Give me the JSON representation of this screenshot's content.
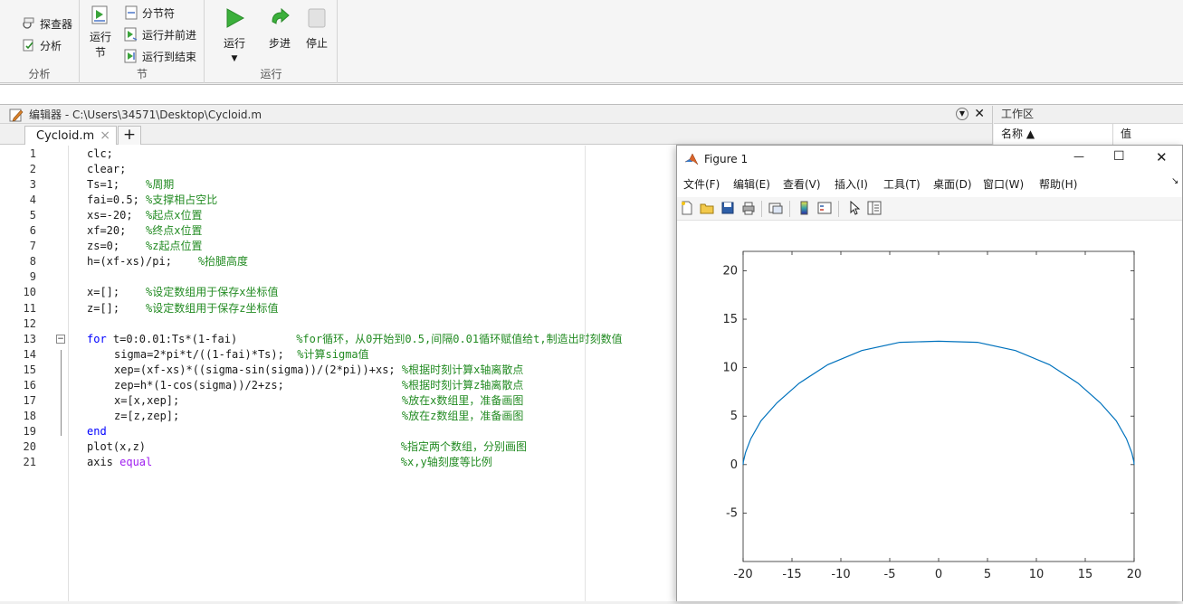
{
  "toolstrip": {
    "explorer_label": "探查器",
    "analyze_label": "分析",
    "analysis_group": "分析",
    "run_section_label_1": "运行",
    "run_section_label_2": "节",
    "section_break_label": "分节符",
    "run_and_advance_label": "运行并前进",
    "run_to_end_label": "运行到结束",
    "section_group": "节",
    "run_label": "运行",
    "step_label": "步进",
    "stop_label": "停止",
    "run_group": "运行"
  },
  "editor": {
    "title": "编辑器 - C:\\Users\\34571\\Desktop\\Cycloid.m",
    "tab_label": "Cycloid.m",
    "close_tab": "×",
    "add_tab": "+"
  },
  "code_lines": [
    {
      "n": "1",
      "indent": "",
      "parts": [
        {
          "t": "clc;",
          "c": ""
        }
      ]
    },
    {
      "n": "2",
      "indent": "",
      "parts": [
        {
          "t": "clear;",
          "c": ""
        }
      ]
    },
    {
      "n": "3",
      "indent": "",
      "parts": [
        {
          "t": "Ts=1;    ",
          "c": ""
        },
        {
          "t": "%周期",
          "c": "cm"
        }
      ]
    },
    {
      "n": "4",
      "indent": "",
      "parts": [
        {
          "t": "fai=0.5; ",
          "c": ""
        },
        {
          "t": "%支撑相占空比",
          "c": "cm"
        }
      ]
    },
    {
      "n": "5",
      "indent": "",
      "parts": [
        {
          "t": "xs=-20;  ",
          "c": ""
        },
        {
          "t": "%起点x位置",
          "c": "cm"
        }
      ]
    },
    {
      "n": "6",
      "indent": "",
      "parts": [
        {
          "t": "xf=20;   ",
          "c": ""
        },
        {
          "t": "%终点x位置",
          "c": "cm"
        }
      ]
    },
    {
      "n": "7",
      "indent": "",
      "parts": [
        {
          "t": "zs=0;    ",
          "c": ""
        },
        {
          "t": "%z起点位置",
          "c": "cm"
        }
      ]
    },
    {
      "n": "8",
      "indent": "",
      "parts": [
        {
          "t": "h=(xf-xs)/pi;    ",
          "c": ""
        },
        {
          "t": "%抬腿高度",
          "c": "cm"
        }
      ]
    },
    {
      "n": "9",
      "indent": "",
      "parts": []
    },
    {
      "n": "10",
      "indent": "",
      "parts": [
        {
          "t": "x=[];    ",
          "c": ""
        },
        {
          "t": "%设定数组用于保存x坐标值",
          "c": "cm"
        }
      ]
    },
    {
      "n": "11",
      "indent": "",
      "parts": [
        {
          "t": "z=[];    ",
          "c": ""
        },
        {
          "t": "%设定数组用于保存z坐标值",
          "c": "cm"
        }
      ]
    },
    {
      "n": "12",
      "indent": "",
      "parts": []
    },
    {
      "n": "13",
      "indent": "",
      "parts": [
        {
          "t": "for",
          "c": "kw"
        },
        {
          "t": " t=0:0.01:Ts*(1-fai)         ",
          "c": ""
        },
        {
          "t": "%for循环，从0开始到0.5,间隔0.01循环赋值给t,制造出时刻数值",
          "c": "cm"
        }
      ]
    },
    {
      "n": "14",
      "indent": "    ",
      "parts": [
        {
          "t": "sigma=2*pi*t/((1-fai)*Ts);  ",
          "c": ""
        },
        {
          "t": "%计算sigma值",
          "c": "cm"
        }
      ]
    },
    {
      "n": "15",
      "indent": "    ",
      "parts": [
        {
          "t": "xep=(xf-xs)*((sigma-sin(sigma))/(2*pi))+xs; ",
          "c": ""
        },
        {
          "t": "%根据时刻计算x轴离散点",
          "c": "cm"
        }
      ]
    },
    {
      "n": "16",
      "indent": "    ",
      "parts": [
        {
          "t": "zep=h*(1-cos(sigma))/2+zs;                  ",
          "c": ""
        },
        {
          "t": "%根据时刻计算z轴离散点",
          "c": "cm"
        }
      ]
    },
    {
      "n": "17",
      "indent": "    ",
      "parts": [
        {
          "t": "x=[x,xep];                                  ",
          "c": ""
        },
        {
          "t": "%放在x数组里，准备画图",
          "c": "cm"
        }
      ]
    },
    {
      "n": "18",
      "indent": "    ",
      "parts": [
        {
          "t": "z=[z,zep];                                  ",
          "c": ""
        },
        {
          "t": "%放在z数组里，准备画图",
          "c": "cm"
        }
      ]
    },
    {
      "n": "19",
      "indent": "",
      "parts": [
        {
          "t": "end",
          "c": "kw"
        }
      ]
    },
    {
      "n": "20",
      "indent": "",
      "parts": [
        {
          "t": "plot(x,z)                                       ",
          "c": ""
        },
        {
          "t": "%指定两个数组，分别画图",
          "c": "cm"
        }
      ]
    },
    {
      "n": "21",
      "indent": "",
      "parts": [
        {
          "t": "axis ",
          "c": ""
        },
        {
          "t": "equal",
          "c": "str"
        },
        {
          "t": "                                      ",
          "c": ""
        },
        {
          "t": "%x,y轴刻度等比例",
          "c": "cm"
        }
      ]
    }
  ],
  "workspace": {
    "title": "工作区",
    "col_name": "名称 ▲",
    "col_value": "值"
  },
  "figure": {
    "title": "Figure 1",
    "menus": [
      "文件(F)",
      "编辑(E)",
      "查看(V)",
      "插入(I)",
      "工具(T)",
      "桌面(D)",
      "窗口(W)",
      "帮助(H)"
    ],
    "minimize": "—",
    "maximize": "☐",
    "close": "✕"
  },
  "chart_data": {
    "type": "line",
    "title": "",
    "xlabel": "",
    "ylabel": "",
    "xlim": [
      -20,
      20
    ],
    "ylim": [
      -10,
      22
    ],
    "xticks": [
      -20,
      -15,
      -10,
      -5,
      0,
      5,
      10,
      15,
      20
    ],
    "yticks": [
      -5,
      0,
      5,
      10,
      15,
      20
    ],
    "line_color": "#0072bd",
    "grid": false,
    "series": [
      {
        "x": [
          -20.0,
          -19.97,
          -19.76,
          -19.21,
          -18.17,
          -16.54,
          -14.25,
          -11.33,
          -7.86,
          -3.98,
          0.0,
          3.98,
          7.86,
          11.33,
          14.25,
          16.54,
          18.17,
          19.21,
          19.76,
          19.97,
          20.0
        ],
        "y": [
          0.0,
          0.31,
          1.22,
          2.67,
          4.53,
          6.37,
          8.41,
          10.31,
          11.77,
          12.61,
          12.73,
          12.61,
          11.77,
          10.31,
          8.41,
          6.37,
          4.53,
          2.67,
          1.22,
          0.31,
          0.0
        ]
      }
    ]
  }
}
